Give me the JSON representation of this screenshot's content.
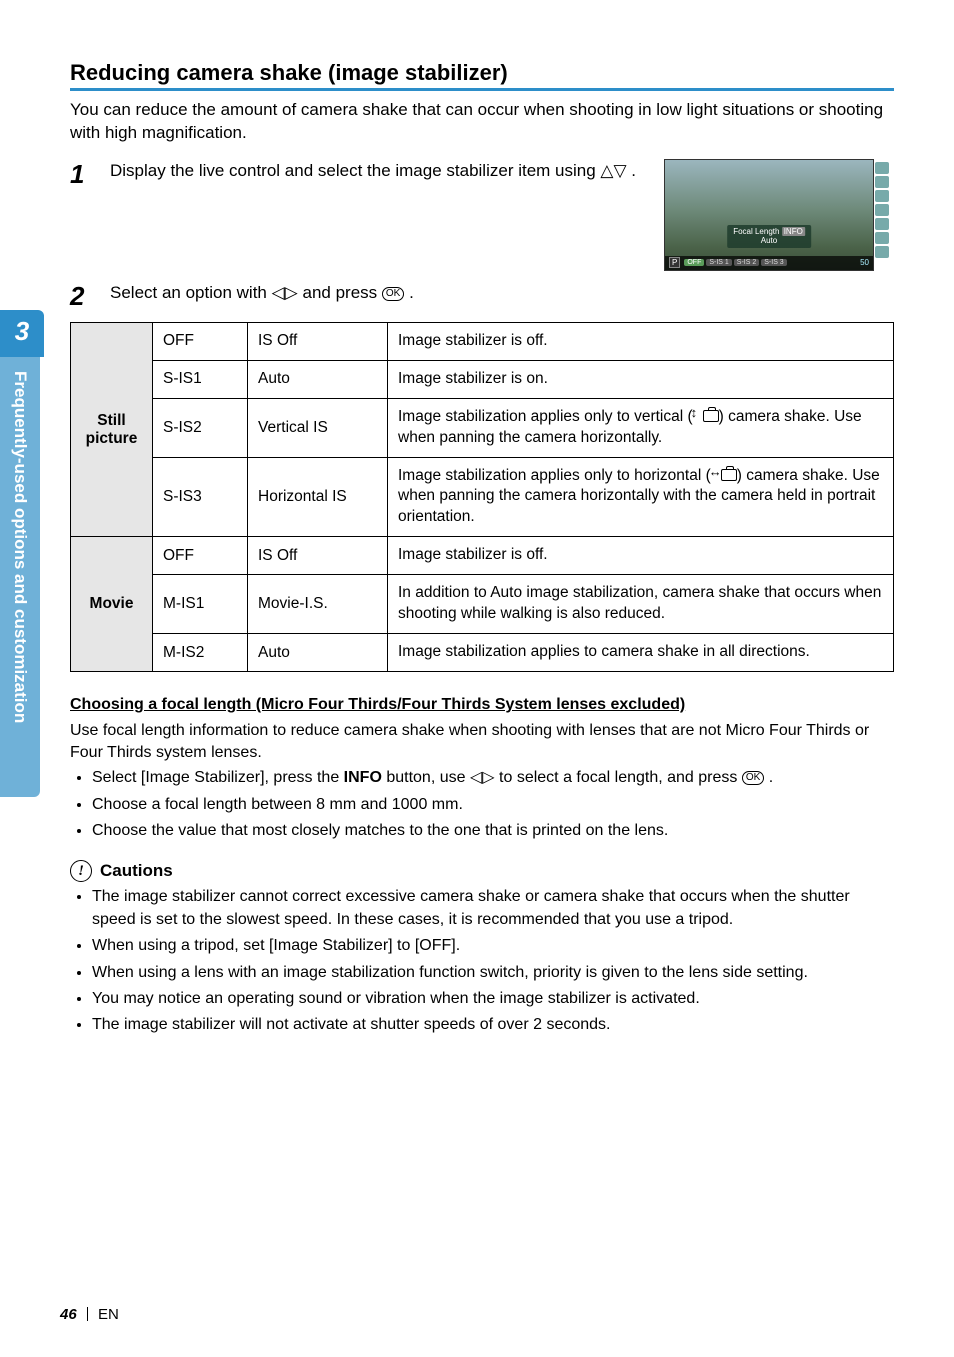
{
  "sidebar": {
    "chapter_number": "3",
    "chapter_label": "Frequently-used options and customization"
  },
  "section": {
    "title": "Reducing camera shake (image stabilizer)",
    "intro": "You can reduce the amount of camera shake that can occur when shooting in low light situations or shooting with high magnification."
  },
  "steps": {
    "s1": {
      "num": "1",
      "text_before": "Display the live control and select the image stabilizer item using ",
      "text_after": "."
    },
    "s2": {
      "num": "2",
      "text_before": "Select an option with ",
      "text_mid": " and press ",
      "text_after": "."
    }
  },
  "thumbnail": {
    "focal": "Focal Length",
    "info": "INFO",
    "auto": "Auto",
    "mode": "P",
    "opts": [
      "OFF",
      "S-IS 1",
      "S-IS 2",
      "S-IS 3"
    ],
    "iso": "50"
  },
  "table": {
    "still_label": "Still picture",
    "movie_label": "Movie",
    "rows": {
      "r1": {
        "code": "OFF",
        "label": "IS Off",
        "desc": "Image stabilizer is off."
      },
      "r2": {
        "code": "S-IS1",
        "label": "Auto",
        "desc": "Image stabilizer is on."
      },
      "r3": {
        "code": "S-IS2",
        "label": "Vertical IS",
        "desc_before": "Image stabilization applies only to vertical (",
        "desc_after": ") camera shake. Use when panning the camera horizontally."
      },
      "r4": {
        "code": "S-IS3",
        "label": "Horizontal IS",
        "desc_before": "Image stabilization applies only to horizontal (",
        "desc_after": ") camera shake. Use when panning the camera horizontally with the camera held in portrait orientation."
      },
      "r5": {
        "code": "OFF",
        "label": "IS Off",
        "desc": "Image stabilizer is off."
      },
      "r6": {
        "code": "M-IS1",
        "label": "Movie-I.S.",
        "desc": "In addition to Auto image stabilization, camera shake that occurs when shooting while walking is also reduced."
      },
      "r7": {
        "code": "M-IS2",
        "label": "Auto",
        "desc": "Image stabilization applies to camera shake in all directions."
      }
    }
  },
  "focal_section": {
    "title": "Choosing a focal length (Micro Four Thirds/Four Thirds System lenses excluded)",
    "intro": "Use focal length information to reduce camera shake when shooting with lenses that are not Micro Four Thirds or Four Thirds system lenses.",
    "b1_a": "Select [Image Stabilizer], press the ",
    "b1_info": "INFO",
    "b1_b": " button, use ",
    "b1_c": " to select a focal length, and press ",
    "b1_d": ".",
    "b2": "Choose a focal length between 8 mm and 1000 mm.",
    "b3": "Choose the value that most closely matches to the one that is printed on the lens."
  },
  "cautions": {
    "heading": "Cautions",
    "items": {
      "c1": "The image stabilizer cannot correct excessive camera shake or camera shake that occurs when the shutter speed is set to the slowest speed. In these cases, it is recommended that you use a tripod.",
      "c2": "When using a tripod, set [Image Stabilizer] to [OFF].",
      "c3": "When using a lens with an image stabilization function switch, priority is given to the lens side setting.",
      "c4": "You may notice an operating sound or vibration when the image stabilizer is activated.",
      "c5": "The image stabilizer will not activate at shutter speeds of over 2 seconds."
    }
  },
  "footer": {
    "page": "46",
    "lang": "EN"
  },
  "glyphs": {
    "updown": "△▽",
    "leftright": "◁▷",
    "ok": "OK"
  }
}
